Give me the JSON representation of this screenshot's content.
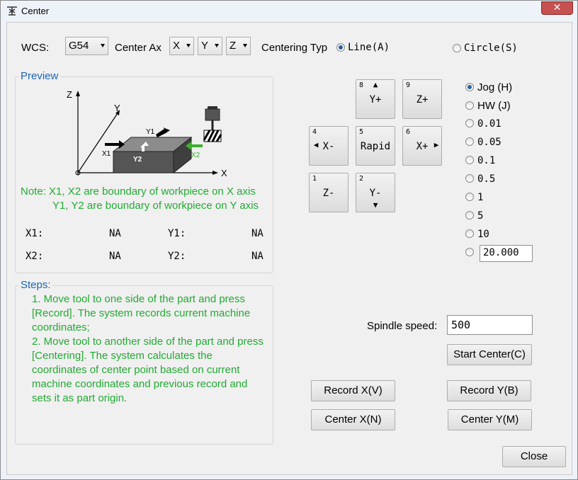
{
  "window": {
    "title": "Center",
    "close_glyph": "✕"
  },
  "wcs": {
    "label": "WCS:",
    "value": "G54"
  },
  "center_axis": {
    "label": "Center Ax",
    "x": "X",
    "y": "Y",
    "z": "Z"
  },
  "centering_type": {
    "label": "Centering Typ",
    "line": "Line(A)",
    "circle": "Circle(S)",
    "selected": "line"
  },
  "preview": {
    "title": "Preview",
    "diagram": {
      "z": "Z",
      "y": "Y",
      "x": "X",
      "x1": "X1",
      "x2": "X2",
      "y1": "Y1",
      "y2": "Y2"
    },
    "note_line1": "Note: X1, X2 are boundary of workpiece on X axis",
    "note_line2": "Y1, Y2 are boundary of workpiece on Y axis",
    "values": {
      "x1_label": "X1:",
      "x1_value": "NA",
      "y1_label": "Y1:",
      "y1_value": "NA",
      "x2_label": "X2:",
      "x2_value": "NA",
      "y2_label": "Y2:",
      "y2_value": "NA"
    }
  },
  "steps": {
    "title": "Steps:",
    "step1": "1. Move tool to one side of the part and press [Record]. The system records current machine coordinates;",
    "step2": "2. Move tool to another side of the part and press [Centering]. The system calculates the coordinates of center point based on current machine coordinates and previous record and sets it as part origin."
  },
  "jog_pad": {
    "y_plus": {
      "num": "8",
      "label": "Y+"
    },
    "z_plus": {
      "num": "9",
      "label": "Z+"
    },
    "x_minus": {
      "num": "4",
      "label": "X-"
    },
    "rapid": {
      "num": "5",
      "label": "Rapid"
    },
    "x_plus": {
      "num": "6",
      "label": "X+"
    },
    "z_minus": {
      "num": "1",
      "label": "Z-"
    },
    "y_minus": {
      "num": "2",
      "label": "Y-"
    }
  },
  "step_modes": {
    "jog": "Jog (H)",
    "hw": "HW (J)",
    "s001": "0.01",
    "s005": "0.05",
    "s01": "0.1",
    "s05": "0.5",
    "s1": "1",
    "s5": "5",
    "s10": "10",
    "custom_value": "20.000",
    "selected": "jog"
  },
  "spindle": {
    "label": "Spindle speed:",
    "value": "500"
  },
  "buttons": {
    "start_center": "Start Center(C)",
    "record_x": "Record X(V)",
    "record_y": "Record Y(B)",
    "center_x": "Center X(N)",
    "center_y": "Center Y(M)",
    "close": "Close"
  },
  "colors": {
    "accent_blue": "#1b64b7",
    "note_green": "#22aa33",
    "arrow_green": "#3cb02a"
  }
}
